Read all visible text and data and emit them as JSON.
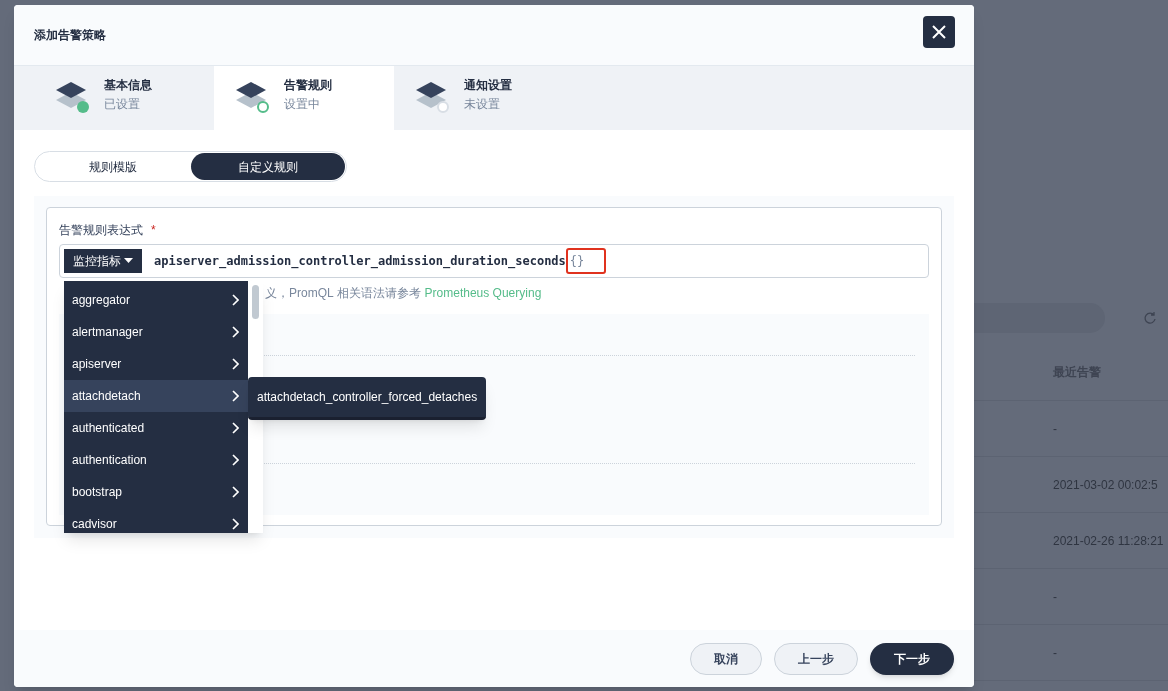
{
  "background": {
    "column_header": "最近告警",
    "cells": [
      "-",
      "2021-03-02 00:02:5",
      "2021-02-26 11:28:21",
      "-",
      "-"
    ]
  },
  "dialog": {
    "title": "添加告警策略",
    "steps": [
      {
        "title": "基本信息",
        "status_text": "已设置",
        "kind": "done",
        "selected": false
      },
      {
        "title": "告警规则",
        "status_text": "设置中",
        "kind": "active",
        "selected": true
      },
      {
        "title": "通知设置",
        "status_text": "未设置",
        "kind": "pending",
        "selected": false
      }
    ],
    "mode_tabs": [
      {
        "label": "规则模版",
        "selected": false
      },
      {
        "label": "自定义规则",
        "selected": true
      }
    ],
    "expression": {
      "label": "告警规则表达式",
      "required_mark": "*",
      "metric_button": "监控指标",
      "value": "apiserver_admission_controller_admission_duration_seconds",
      "braces": "{}"
    },
    "hint": {
      "text": "义，PromQL 相关语法请参考",
      "link": "Prometheus Querying"
    },
    "metric_menu": [
      {
        "label": "aggregator",
        "selected": false
      },
      {
        "label": "alertmanager",
        "selected": false
      },
      {
        "label": "apiserver",
        "selected": false
      },
      {
        "label": "attachdetach",
        "selected": true,
        "children": [
          "attachdetach_controller_forced_detaches"
        ]
      },
      {
        "label": "authenticated",
        "selected": false
      },
      {
        "label": "authentication",
        "selected": false
      },
      {
        "label": "bootstrap",
        "selected": false
      },
      {
        "label": "cadvisor",
        "selected": false
      }
    ],
    "buttons": [
      {
        "label": "取消",
        "kind": "secondary"
      },
      {
        "label": "上一步",
        "kind": "secondary"
      },
      {
        "label": "下一步",
        "kind": "primary"
      }
    ]
  }
}
